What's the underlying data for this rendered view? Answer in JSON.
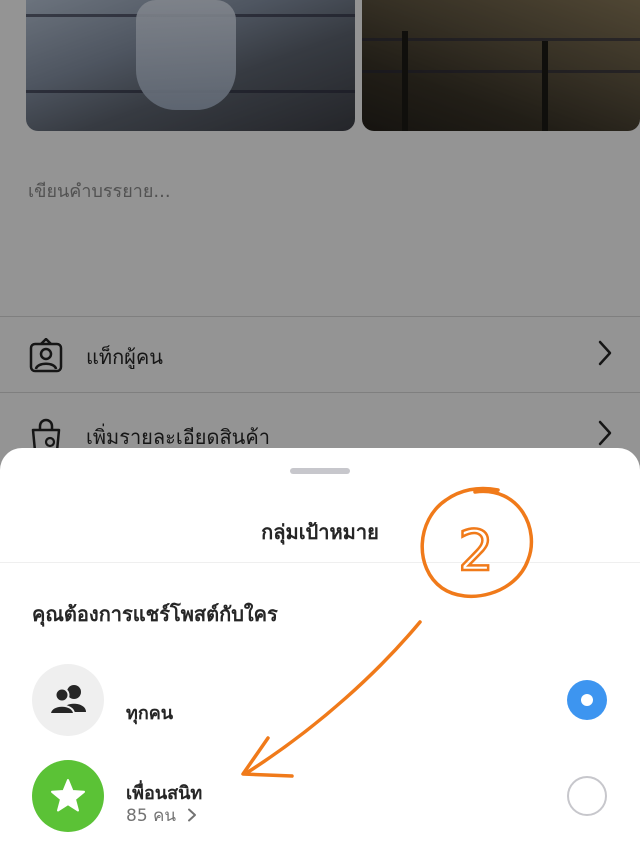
{
  "composer": {
    "caption_placeholder": "เขียนคำบรรยาย...",
    "rows": [
      {
        "label": "แท็กผู้คน",
        "icon": "tag-people-icon"
      },
      {
        "label": "เพิ่มรายละเอียดสินค้า",
        "icon": "shopping-bag-icon"
      }
    ]
  },
  "sheet": {
    "title": "กลุ่มเป้าหมาย",
    "question": "คุณต้องการแชร์โพสต์กับใคร",
    "options": [
      {
        "title": "ทุกคน",
        "subtitle": "",
        "icon": "people-icon",
        "selected": true
      },
      {
        "title": "เพื่อนสนิท",
        "subtitle": "85 คน",
        "icon": "star-icon",
        "selected": false
      }
    ]
  },
  "annotation": {
    "label": "2",
    "color": "#f07a1a"
  },
  "colors": {
    "accent": "#3d95f0",
    "close_friends": "#5bc236",
    "overlay": "rgba(0,0,0,0.42)"
  }
}
